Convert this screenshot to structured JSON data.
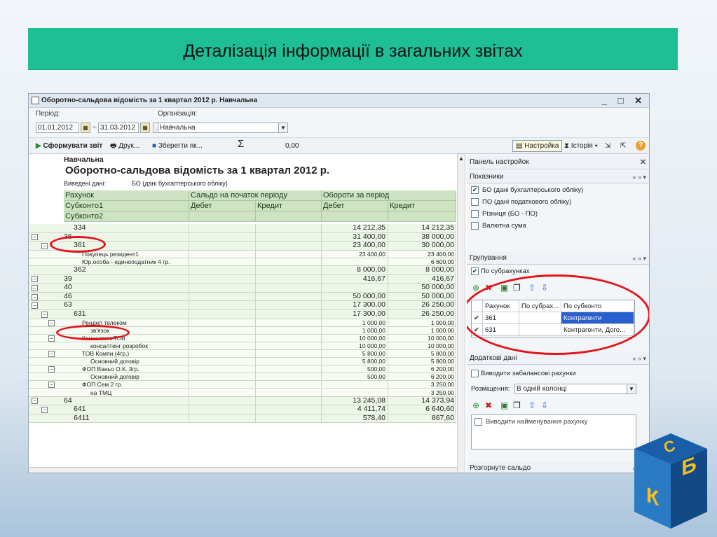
{
  "slide": {
    "title": "Деталізація інформації в загальних звітах"
  },
  "window": {
    "title": "Оборотно-сальдова відомість за 1 квартал 2012 р. Навчальна",
    "controls": "_ □ ✕",
    "period_label": "Період:",
    "period_from": "01.01.2012",
    "period_dash": "–",
    "period_to": "31.03.2012",
    "ellipsis": "...",
    "org_label": "Організація:",
    "org_value": "Навчальна",
    "toolbar": {
      "generate": "Сформувати звіт",
      "print": "Друк...",
      "save": "Зберегти як...",
      "sigma": "Σ",
      "sum_value": "0,00",
      "settings": "Настройка",
      "history": "Історія ▾",
      "help": "?"
    }
  },
  "report": {
    "org": "Навчальна",
    "title": "Оборотно-сальдова відомість за 1 квартал 2012 р.",
    "data_label": "Виведені дані:",
    "data_value": "БО (дані бухгалтерського обліку)",
    "columns": {
      "account": "Рахунок",
      "subkonto1": "Субконто1",
      "subkonto2": "Субконто2",
      "opening": "Сальдо на початок періоду",
      "turnover": "Обороти за період",
      "debit": "Дебет",
      "credit": "Кредит",
      "debit2": "Дебет",
      "credit2": "Кредит"
    },
    "rows": [
      {
        "account": "334",
        "level": 1,
        "debit": "14 212,35",
        "credit": "14 212,35"
      },
      {
        "account": "36",
        "level": 0,
        "debit": "31 400,00",
        "credit": "38 000,00"
      },
      {
        "account": "361",
        "level": 1,
        "debit": "23 400,00",
        "credit": "30 000,00"
      },
      {
        "account": "Покупець резидент1",
        "level": 2,
        "debit": "23 400,00",
        "credit": "23 400,00"
      },
      {
        "account": "Юр.особа - единоподатник 4 гр.",
        "level": 2,
        "debit": "",
        "credit": "6 600,00"
      },
      {
        "account": "362",
        "level": 1,
        "debit": "8 000,00",
        "credit": "8 000,00"
      },
      {
        "account": "39",
        "level": 0,
        "debit": "416,67",
        "credit": "416,67"
      },
      {
        "account": "40",
        "level": 0,
        "debit": "",
        "credit": "50 000,00"
      },
      {
        "account": "46",
        "level": 0,
        "debit": "50 000,00",
        "credit": "50 000,00"
      },
      {
        "account": "63",
        "level": 0,
        "debit": "17 300,00",
        "credit": "26 250,00"
      },
      {
        "account": "631",
        "level": 1,
        "debit": "17 300,00",
        "credit": "26 250,00"
      },
      {
        "account": "Рендел телеком",
        "level": 2,
        "debit": "1 000,00",
        "credit": "1 000,00"
      },
      {
        "account": "зв'язок",
        "level": 3,
        "debit": "1 000,00",
        "credit": "1 000,00"
      },
      {
        "account": "КонсалтингТОВ",
        "level": 2,
        "debit": "10 000,00",
        "credit": "10 000,00"
      },
      {
        "account": "консалтинг розробок",
        "level": 3,
        "debit": "10 000,00",
        "credit": "10 000,00"
      },
      {
        "account": "ТОВ Компи (4гр.)",
        "level": 2,
        "debit": "5 800,00",
        "credit": "5 800,00"
      },
      {
        "account": "Основний договір",
        "level": 3,
        "debit": "5 800,00",
        "credit": "5 800,00"
      },
      {
        "account": "ФОП Ваньо О.К. 3гр.",
        "level": 2,
        "debit": "500,00",
        "credit": "6 200,00"
      },
      {
        "account": "Основний договір",
        "level": 3,
        "debit": "500,00",
        "credit": "6 200,00"
      },
      {
        "account": "ФОП Сем 2 гр.",
        "level": 2,
        "debit": "",
        "credit": "3 250,00"
      },
      {
        "account": "на ТМЦ",
        "level": 3,
        "debit": "",
        "credit": "3 250,00"
      },
      {
        "account": "64",
        "level": 0,
        "debit": "13 245,08",
        "credit": "14 373,94"
      },
      {
        "account": "641",
        "level": 1,
        "debit": "4 411,74",
        "credit": "6 640,60"
      },
      {
        "account": "6411",
        "level": 1,
        "debit": "578,40",
        "credit": "867,60"
      }
    ]
  },
  "panel": {
    "title": "Панель настройок",
    "indicators_title": "Показники",
    "indicators": [
      {
        "label": "БО (дані бухгалтерського обліку)",
        "checked": true
      },
      {
        "label": "ПО (дані податкового обліку)",
        "checked": false
      },
      {
        "label": "Різниця (БО - ПО)",
        "checked": false
      },
      {
        "label": "Валютна сума",
        "checked": false
      }
    ],
    "grouping_title": "Групування",
    "grouping_check": "По субрахунках",
    "grouping_columns": [
      "Рахунок",
      "По субрах...",
      "По субконто"
    ],
    "grouping_rows": [
      {
        "account": "361",
        "sub": "",
        "subkonto": "Контрагенти"
      },
      {
        "account": "631",
        "sub": "",
        "subkonto": "Контрагенти, Дого..."
      }
    ],
    "additional_title": "Додаткові дані",
    "offbalance": "Виводити забалансові рахунки",
    "placement_label": "Розміщення:",
    "placement_value": "В одній колонці",
    "show_names": "Виводити найменування рахунку",
    "expand_title": "Розгорнуте сальдо",
    "nav": "« » ▾"
  }
}
